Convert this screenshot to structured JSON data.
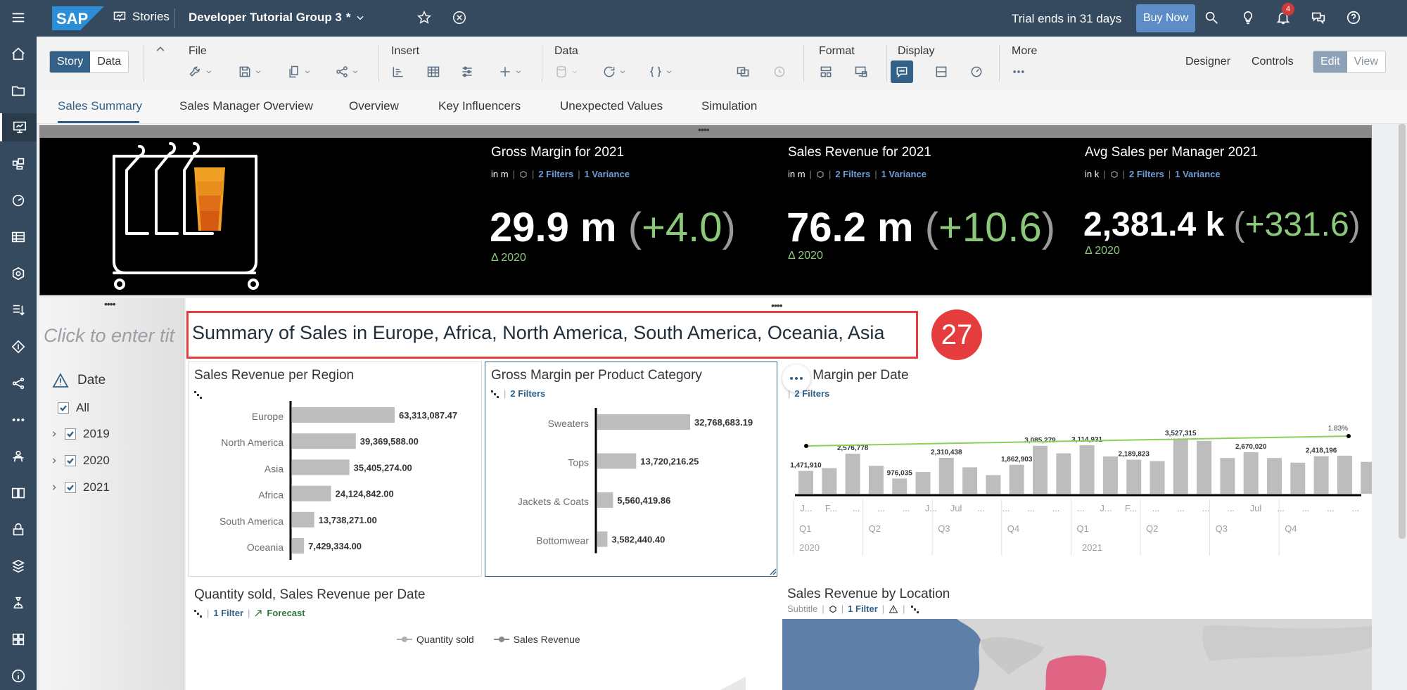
{
  "shell": {
    "app_name": "SAP",
    "nav_label": "Stories",
    "story_title": "Developer Tutorial Group 3",
    "dirty_marker": "*",
    "trial_text": "Trial ends in 31 days",
    "buy_now": "Buy Now",
    "notification_count": "4"
  },
  "toolbar": {
    "mode_story": "Story",
    "mode_data": "Data",
    "file_label": "File",
    "insert_label": "Insert",
    "data_label": "Data",
    "format_label": "Format",
    "display_label": "Display",
    "more_label": "More",
    "designer": "Designer",
    "controls": "Controls",
    "edit": "Edit",
    "view": "View"
  },
  "tabs": [
    "Sales Summary",
    "Sales Manager Overview",
    "Overview",
    "Key Influencers",
    "Unexpected Values",
    "Simulation"
  ],
  "kpis": [
    {
      "title": "Gross Margin for 2021",
      "unit": "in m",
      "filters": "2 Filters",
      "variance": "1 Variance",
      "value": "29.9 m",
      "change": "+4.0",
      "delta": "Δ 2020"
    },
    {
      "title": "Sales Revenue for 2021",
      "unit": "in m",
      "filters": "2 Filters",
      "variance": "1 Variance",
      "value": "76.2 m",
      "change": "+10.6",
      "delta": "Δ 2020"
    },
    {
      "title": "Avg Sales per Manager 2021",
      "unit": "in k",
      "filters": "2 Filters",
      "variance": "1 Variance",
      "value": "2,381.4 k",
      "change": "+331.6",
      "delta": "Δ 2020"
    }
  ],
  "filter_panel": {
    "placeholder": "Click to enter tit",
    "date_label": "Date",
    "all_label": "All",
    "years": [
      "2019",
      "2020",
      "2021"
    ]
  },
  "story": {
    "title": "Summary of Sales in Europe, Africa, North America, South America, Oceania, Asia",
    "step_badge": "27"
  },
  "tiles": {
    "region": {
      "title": "Sales Revenue per Region"
    },
    "category": {
      "title": "Gross Margin per Product Category",
      "filters": "2 Filters"
    },
    "date": {
      "title": "ss Margin per Date",
      "filters": "2 Filters"
    },
    "qty": {
      "title": "Quantity sold, Sales Revenue per Date",
      "filters": "1 Filter",
      "forecast": "Forecast",
      "legend": [
        "Quantity sold",
        "Sales Revenue"
      ]
    },
    "location": {
      "title": "Sales Revenue by Location",
      "subtitle": "Subtitle",
      "filters": "1 Filter"
    }
  },
  "chart_data": [
    {
      "type": "bar",
      "title": "Sales Revenue per Region",
      "categories": [
        "Europe",
        "North America",
        "Asia",
        "Africa",
        "South America",
        "Oceania"
      ],
      "values": [
        63313087.47,
        39369588.0,
        35405274.0,
        24124842.0,
        13738271.0,
        7429334.0
      ],
      "labels": [
        "63,313,087.47",
        "39,369,588.00",
        "35,405,274.00",
        "24,124,842.00",
        "13,738,271.00",
        "7,429,334.00"
      ],
      "orientation": "horizontal"
    },
    {
      "type": "bar",
      "title": "Gross Margin per Product Category",
      "categories": [
        "Sweaters",
        "Tops",
        "Jackets & Coats",
        "Bottomwear"
      ],
      "values": [
        32768683.19,
        13720216.25,
        5560419.86,
        3582440.4
      ],
      "labels": [
        "32,768,683.19",
        "13,720,216.25",
        "5,560,419.86",
        "3,582,440.40"
      ],
      "orientation": "horizontal"
    },
    {
      "type": "bar",
      "title": "ss Margin per Date",
      "values": [
        1471910,
        1650000,
        2576778,
        1800000,
        976035,
        1400000,
        2310438,
        1700000,
        1200000,
        1862903,
        3085279,
        2600000,
        3114931,
        2400000,
        2189823,
        2100000,
        3527315,
        3400000,
        2300000,
        2670020,
        2300000,
        2000000,
        2418196,
        2450000,
        2050000,
        2050000,
        2300000
      ],
      "data_labels": [
        "1,471,910",
        "",
        "2,576,778",
        "",
        "976,035",
        "",
        "2,310,438",
        "",
        "",
        "1,862,903",
        "3,085,279",
        "",
        "3,114,931",
        "",
        "2,189,823",
        "",
        "3,527,315",
        "",
        "",
        "2,670,020",
        "",
        "",
        "2,418,196",
        "",
        "",
        "",
        ""
      ],
      "trend_label": "1.83%",
      "x_tick_labels": [
        "J...",
        "F...",
        "...",
        "...",
        "...",
        "J...",
        "Jul",
        "...",
        "...",
        "...",
        "...",
        "...",
        "J...",
        "F...",
        "...",
        "...",
        "...",
        "...",
        "Jul",
        "...",
        "...",
        "...",
        "..."
      ],
      "quarter_labels": [
        "Q1",
        "Q2",
        "Q3",
        "Q4",
        "Q1",
        "Q2",
        "Q3",
        "Q4"
      ],
      "year_labels": [
        "2020",
        "2021"
      ]
    }
  ]
}
